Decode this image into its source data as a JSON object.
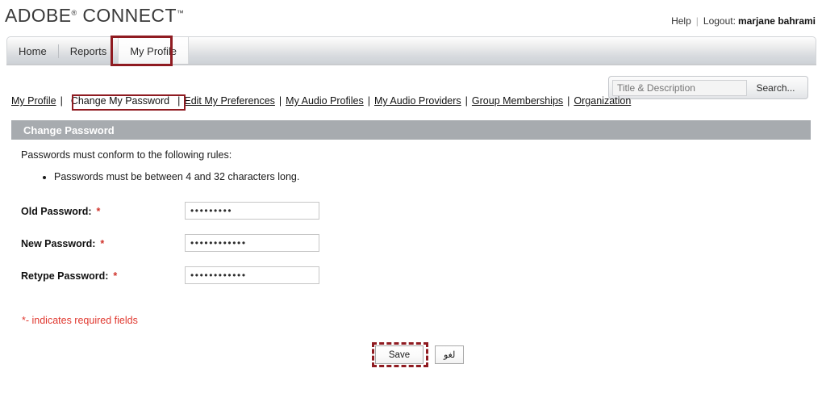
{
  "brand": {
    "name_primary": "ADOBE",
    "registered_mark": "®",
    "name_secondary": "CONNECT",
    "trademark_mark": "™"
  },
  "account_bar": {
    "help_label": "Help",
    "separator": "|",
    "logout_label": "Logout:",
    "user_name": "marjane bahrami"
  },
  "tabs": [
    {
      "label": "Home",
      "active": false
    },
    {
      "label": "Reports",
      "active": false
    },
    {
      "label": "My Profile",
      "active": true
    }
  ],
  "search": {
    "placeholder": "Title & Description",
    "value": "",
    "button_label": "Search..."
  },
  "subnav": {
    "separator": "|",
    "items": [
      {
        "label": "My Profile",
        "current": false
      },
      {
        "label": "Change My Password",
        "current": true
      },
      {
        "label": "Edit My Preferences",
        "current": false
      },
      {
        "label": "My Audio Profiles",
        "current": false
      },
      {
        "label": "My Audio Providers",
        "current": false
      },
      {
        "label": "Group Memberships",
        "current": false
      },
      {
        "label": "Organization",
        "current": false
      }
    ]
  },
  "section": {
    "title": "Change Password",
    "intro": "Passwords must conform to the following rules:",
    "rules": [
      "Passwords must be between 4 and 32 characters long."
    ]
  },
  "form": {
    "required_marker": "*",
    "fields": [
      {
        "label": "Old Password:",
        "value": "•••••••••",
        "required": true
      },
      {
        "label": "New Password:",
        "value": "••••••••••••",
        "required": true
      },
      {
        "label": "Retype Password:",
        "value": "••••••••••••",
        "required": true
      }
    ],
    "required_note": "*- indicates required fields"
  },
  "buttons": {
    "save_label": "Save",
    "cancel_label": "لغو"
  },
  "colors": {
    "annotation_red": "#8f1b21",
    "section_header_gray": "#a7abaf",
    "required_red": "#d0342c",
    "note_red": "#e0382f"
  }
}
